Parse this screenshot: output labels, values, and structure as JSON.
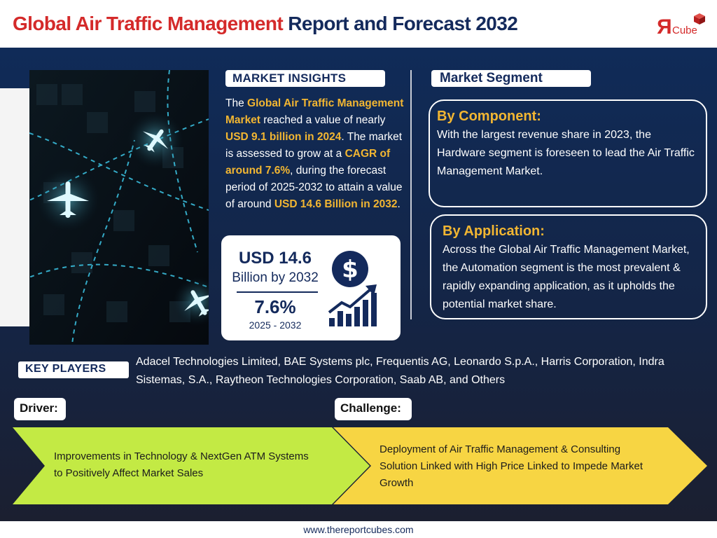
{
  "header": {
    "title_part1": "Global Air Traffic Management",
    "title_part2": "Report and Forecast 2032",
    "logo_r": "R",
    "logo_text": "Cube"
  },
  "market_insights": {
    "label": "MARKET INSIGHTS",
    "t1": "The ",
    "h1": "Global Air Traffic Management Market",
    "t2": " reached a value of nearly ",
    "h2": "USD 9.1 billion in 2024",
    "t3": ". The market is assessed to grow at a ",
    "h3": "CAGR of around 7.6%",
    "t4": ", during the forecast period of 2025-2032 to attain a value of around ",
    "h4": "USD 14.6 Billion in 2032",
    "t5": "."
  },
  "stats": {
    "value": "USD 14.6",
    "value_caption": "Billion by 2032",
    "cagr": "7.6%",
    "period": "2025 - 2032"
  },
  "market_segment": {
    "label": "Market Segment",
    "component": {
      "heading": "By Component:",
      "text": "With the largest revenue share in 2023, the Hardware segment is foreseen to lead the Air Traffic Management Market."
    },
    "application": {
      "heading": "By Application:",
      "text": "Across the Global Air Traffic Management Market, the Automation segment is the most prevalent & rapidly expanding application, as it upholds the potential market share."
    }
  },
  "key_players": {
    "label": "KEY PLAYERS",
    "text": "Adacel Technologies Limited, BAE Systems plc, Frequentis AG, Leonardo S.p.A., Harris Corporation, Indra Sistemas, S.A., Raytheon Technologies Corporation, Saab AB, and Others"
  },
  "driver": {
    "label": "Driver:",
    "text": "Improvements in Technology & NextGen ATM Systems to Positively Affect Market Sales"
  },
  "challenge": {
    "label": "Challenge:",
    "text": "Deployment of Air Traffic Management & Consulting Solution Linked with High Price Linked to Impede Market Growth"
  },
  "footer": {
    "url": "www.thereportcubes.com"
  },
  "colors": {
    "brand_red": "#d42a2a",
    "navy": "#142a5c",
    "highlight": "#f2b632",
    "driver_green": "#c3ea44",
    "challenge_yellow": "#f7d543"
  },
  "icons": [
    "airplane-icon",
    "dollar-icon",
    "growth-chart-icon",
    "cube-icon"
  ]
}
